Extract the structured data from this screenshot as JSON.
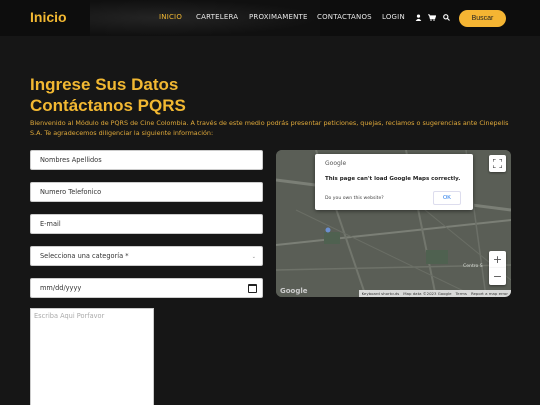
{
  "nav": {
    "brand": "Inicio",
    "items": [
      "INICIO",
      "CARTELERA",
      "PROXIMAMENTE",
      "CONTACTANOS",
      "LOGIN"
    ],
    "search_label": "Buscar",
    "accent": "#f2b832"
  },
  "page": {
    "heading_1": "Ingrese Sus Datos",
    "heading_2": "Contáctanos PQRS",
    "intro": "Bienvenido al Módulo de PQRS de Cine Colombia. A través de este medio podrás presentar peticiones, quejas, reclamos o sugerencias ante Cinepelis S.A. Te agradecemos diligenciar la siguiente información:"
  },
  "form": {
    "name_placeholder": "Nombres Apellidos",
    "phone_placeholder": "Numero Telefonico",
    "email_placeholder": "E-mail",
    "category_value": "Selecciona una categoría *",
    "date_placeholder": "mm/dd/yyyy",
    "message_placeholder": "Escriba Aqui Porfavor"
  },
  "map": {
    "dialog_logo": "Google",
    "dialog_message": "This page can't load Google Maps correctly.",
    "dialog_link": "Do you own this website?",
    "dialog_ok": "OK",
    "labels": [
      "Embajada de los Estados Unidos",
      "Centro S"
    ],
    "footer": [
      "Keyboard shortcuts",
      "Map data ©2023 Google",
      "Terms",
      "Report a map error"
    ],
    "google_logo": "Google",
    "zoom_in": "+",
    "zoom_out": "−"
  }
}
